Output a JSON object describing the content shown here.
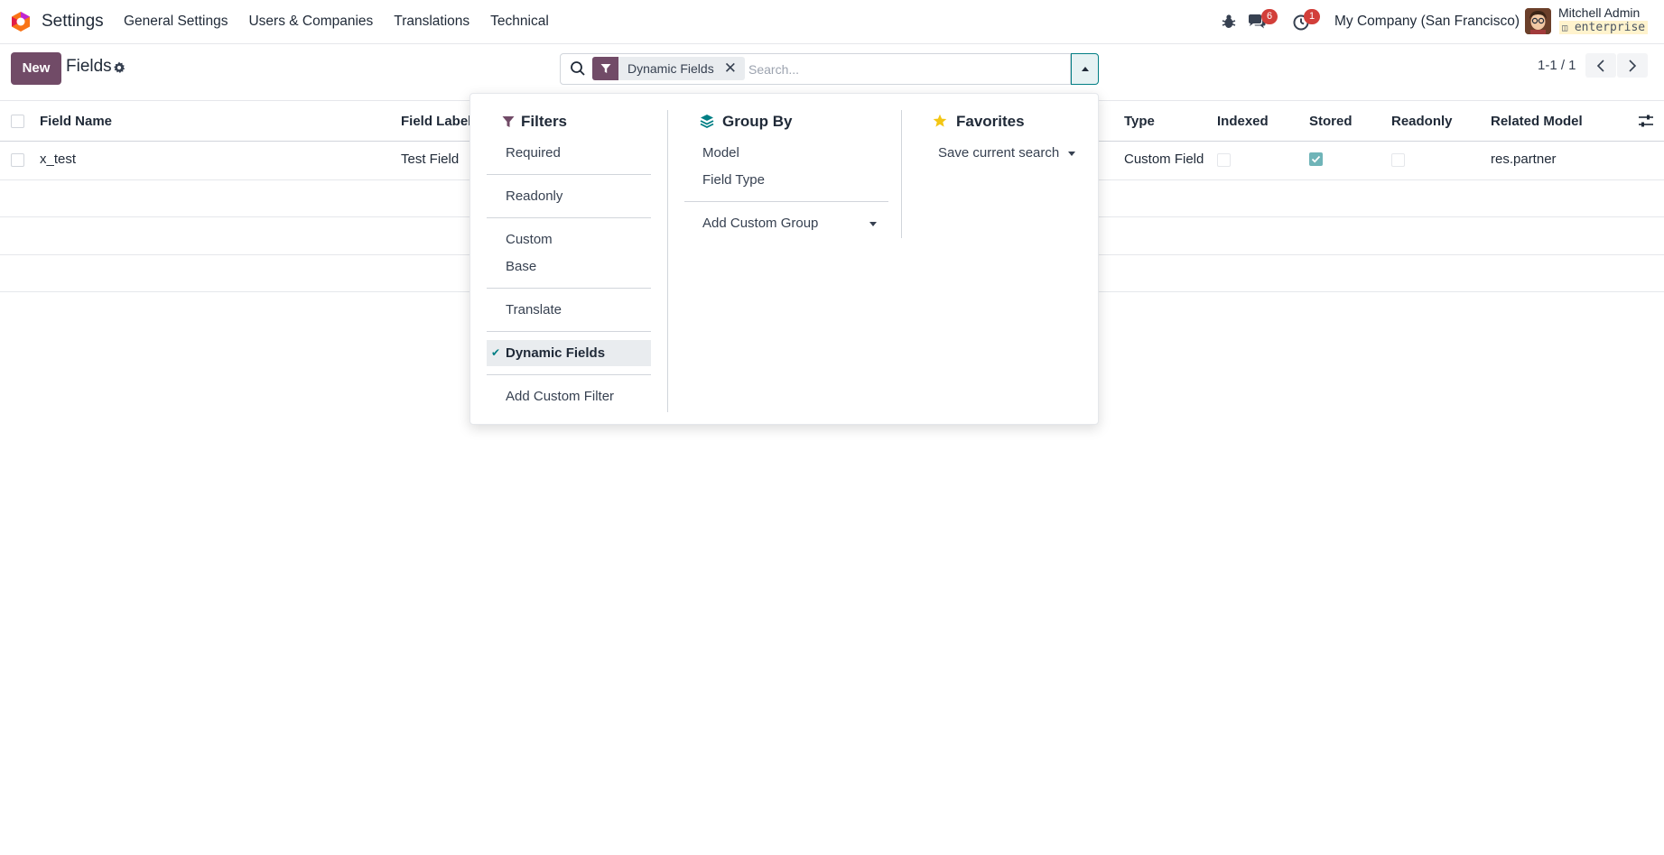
{
  "navbar": {
    "app_name": "Settings",
    "menu": [
      "General Settings",
      "Users & Companies",
      "Translations",
      "Technical"
    ],
    "messages_badge": "6",
    "activity_badge": "1",
    "company": "My Company (San Francisco)",
    "user_name": "Mitchell Admin",
    "db_name": "enterprise"
  },
  "control_panel": {
    "new_label": "New",
    "title": "Fields",
    "facet_label": "Dynamic Fields",
    "search_placeholder": "Search...",
    "pager": "1-1 / 1"
  },
  "list": {
    "columns": [
      "Field Name",
      "Field Label",
      "Type",
      "Indexed",
      "Stored",
      "Readonly",
      "Related Model"
    ],
    "rows": [
      {
        "field_name": "x_test",
        "field_label": "Test Field",
        "type": "Custom Field",
        "indexed": false,
        "stored": true,
        "readonly": false,
        "related_model": "res.partner"
      }
    ]
  },
  "dropdown": {
    "filters_title": "Filters",
    "filters": [
      "Required",
      "Readonly",
      "Custom",
      "Base",
      "Translate",
      "Dynamic Fields",
      "Add Custom Filter"
    ],
    "groupby_title": "Group By",
    "groupby": [
      "Model",
      "Field Type",
      "Add Custom Group"
    ],
    "favorites_title": "Favorites",
    "favorites": [
      "Save current search"
    ]
  },
  "colors": {
    "primary": "#714b67",
    "accent": "#017e84",
    "badge": "#d23f3a"
  }
}
